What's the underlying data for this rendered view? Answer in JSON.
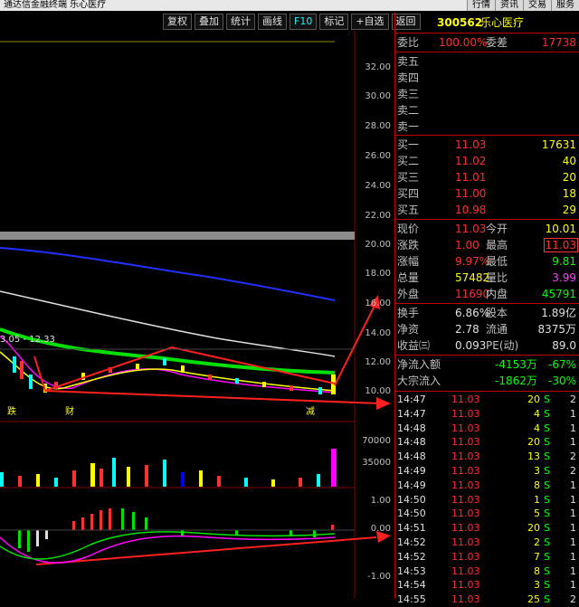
{
  "titlebar": {
    "title": "通达信金融终端  乐心医疗"
  },
  "topmenu": [
    "行情",
    "资讯",
    "交易",
    "服务"
  ],
  "toolbar": [
    "复权",
    "叠加",
    "统计",
    "画线",
    "F10",
    "标记",
    "+自选",
    "返回"
  ],
  "stock": {
    "code": "300562",
    "name": "乐心医疗"
  },
  "orderbook": {
    "webi_label": "委比",
    "webi_value": "100.00%",
    "weicha_label": "委差",
    "weicha_value": "17738",
    "sells": [
      {
        "label": "卖五",
        "price": "",
        "vol": ""
      },
      {
        "label": "卖四",
        "price": "",
        "vol": ""
      },
      {
        "label": "卖三",
        "price": "",
        "vol": ""
      },
      {
        "label": "卖二",
        "price": "",
        "vol": ""
      },
      {
        "label": "卖一",
        "price": "",
        "vol": ""
      }
    ],
    "buys": [
      {
        "label": "买一",
        "price": "11.03",
        "vol": "17631"
      },
      {
        "label": "买二",
        "price": "11.02",
        "vol": "40"
      },
      {
        "label": "买三",
        "price": "11.01",
        "vol": "20"
      },
      {
        "label": "买四",
        "price": "11.00",
        "vol": "18"
      },
      {
        "label": "买五",
        "price": "10.98",
        "vol": "29"
      }
    ]
  },
  "quote": [
    {
      "l1": "现价",
      "v1": "11.03",
      "l2": "今开",
      "v2": "10.01"
    },
    {
      "l1": "涨跌",
      "v1": "1.00",
      "l2": "最高",
      "v2": "11.03"
    },
    {
      "l1": "涨幅",
      "v1": "9.97%",
      "l2": "最低",
      "v2": "9.81"
    },
    {
      "l1": "总量",
      "v1": "57482",
      "l2": "量比",
      "v2": "3.99"
    },
    {
      "l1": "外盘",
      "v1": "11690",
      "l2": "内盘",
      "v2": "45791"
    }
  ],
  "fund": [
    {
      "l1": "换手",
      "v1": "6.86%",
      "l2": "股本",
      "v2": "1.89亿"
    },
    {
      "l1": "净资",
      "v1": "2.78",
      "l2": "流通",
      "v2": "8375万"
    },
    {
      "l1": "收益㈢",
      "v1": "0.093",
      "l2": "PE(动)",
      "v2": "89.0"
    }
  ],
  "flow": [
    {
      "label": "净流入额",
      "v1": "-4153万",
      "v2": "-67%"
    },
    {
      "label": "大宗流入",
      "v1": "-1862万",
      "v2": "-30%"
    }
  ],
  "ticks": [
    {
      "time": "14:47",
      "price": "11.03",
      "vol": "20",
      "side": "S",
      "n": "2"
    },
    {
      "time": "14:47",
      "price": "11.03",
      "vol": "4",
      "side": "S",
      "n": "1"
    },
    {
      "time": "14:48",
      "price": "11.03",
      "vol": "4",
      "side": "S",
      "n": "1"
    },
    {
      "time": "14:48",
      "price": "11.03",
      "vol": "20",
      "side": "S",
      "n": "1"
    },
    {
      "time": "14:48",
      "price": "11.03",
      "vol": "13",
      "side": "S",
      "n": "2"
    },
    {
      "time": "14:49",
      "price": "11.03",
      "vol": "3",
      "side": "S",
      "n": "2"
    },
    {
      "time": "14:49",
      "price": "11.03",
      "vol": "8",
      "side": "S",
      "n": "1"
    },
    {
      "time": "14:50",
      "price": "11.03",
      "vol": "1",
      "side": "S",
      "n": "1"
    },
    {
      "time": "14:50",
      "price": "11.03",
      "vol": "5",
      "side": "S",
      "n": "1"
    },
    {
      "time": "14:51",
      "price": "11.03",
      "vol": "20",
      "side": "S",
      "n": "1"
    },
    {
      "time": "14:52",
      "price": "11.03",
      "vol": "2",
      "side": "S",
      "n": "1"
    },
    {
      "time": "14:52",
      "price": "11.03",
      "vol": "7",
      "side": "S",
      "n": "1"
    },
    {
      "time": "14:53",
      "price": "11.03",
      "vol": "8",
      "side": "S",
      "n": "1"
    },
    {
      "time": "14:54",
      "price": "11.03",
      "vol": "3",
      "side": "S",
      "n": "1"
    },
    {
      "time": "14:55",
      "price": "11.03",
      "vol": "25",
      "side": "S",
      "n": "2"
    }
  ],
  "chart": {
    "price_ticks": [
      "32.00",
      "30.00",
      "28.00",
      "26.00",
      "24.00",
      "22.00",
      "20.00",
      "18.00",
      "16.00",
      "14.00",
      "12.00",
      "10.00"
    ],
    "vol_ticks": [
      "70000",
      "35000"
    ],
    "macd_ticks": [
      "1.00",
      "0.00",
      "-1.00"
    ],
    "date_range_label": "3.05 - 12.33",
    "annotations": [
      "跌",
      "财",
      "减"
    ]
  },
  "colors": {
    "up": "#ff3030",
    "down": "#00ffff",
    "yellow": "#ffff00",
    "accent": "#c00000"
  }
}
